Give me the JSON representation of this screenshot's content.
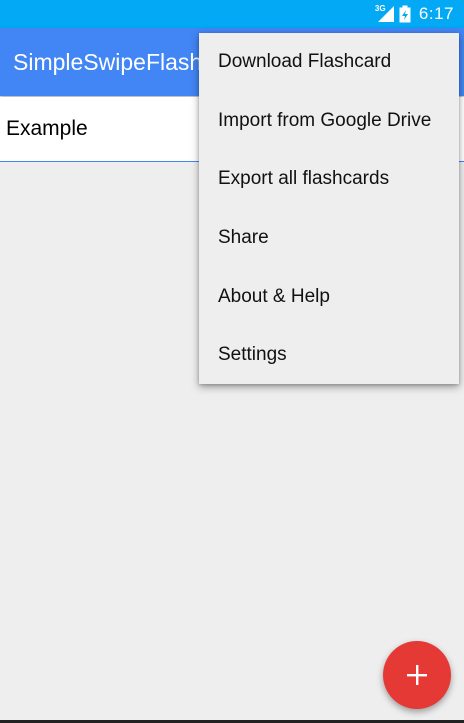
{
  "status_bar": {
    "network_label": "3G",
    "time": "6:17",
    "background": "#03a9f4"
  },
  "app_bar": {
    "title": "SimpleSwipeFlashcards",
    "background": "#4285f4"
  },
  "list": {
    "items": [
      {
        "label": "Example"
      }
    ]
  },
  "overflow_menu": {
    "items": [
      {
        "label": "Download Flashcard"
      },
      {
        "label": "Import from Google Drive"
      },
      {
        "label": "Export all flashcards"
      },
      {
        "label": "Share"
      },
      {
        "label": "About & Help"
      },
      {
        "label": "Settings"
      }
    ]
  },
  "fab": {
    "icon": "plus-icon",
    "color": "#e53935"
  }
}
